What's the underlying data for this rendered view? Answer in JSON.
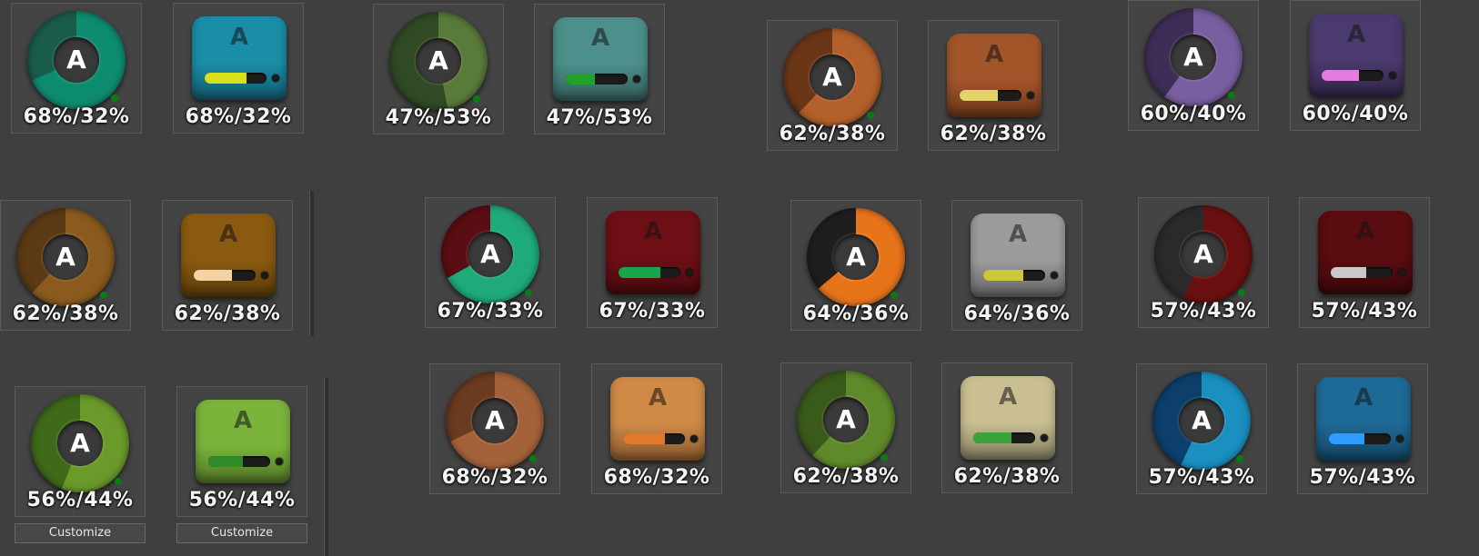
{
  "drive_letter": "A",
  "tiles": [
    {
      "caption": "68%/32%",
      "used_fraction": 0.68,
      "kind": "ring",
      "color": "#0e8c6f",
      "alt": "#1a5c4b"
    },
    {
      "caption": "68%/32%",
      "used_fraction": 0.68,
      "kind": "drive",
      "color": "#1a8ea8",
      "alt": "#d8e01a"
    },
    {
      "caption": "47%/53%",
      "used_fraction": 0.47,
      "kind": "ring",
      "color": "#5a7a3a",
      "alt": "#2f4a24"
    },
    {
      "caption": "47%/53%",
      "used_fraction": 0.47,
      "kind": "drive",
      "color": "#4d8f8a",
      "alt": "#1fa32a"
    },
    {
      "caption": "62%/38%",
      "used_fraction": 0.62,
      "kind": "ring",
      "color": "#b3602a",
      "alt": "#6b3618"
    },
    {
      "caption": "62%/38%",
      "used_fraction": 0.62,
      "kind": "drive",
      "color": "#a3552a",
      "alt": "#e2d36a"
    },
    {
      "caption": "60%/40%",
      "used_fraction": 0.6,
      "kind": "ring",
      "color": "#7a5fa0",
      "alt": "#3e2e57"
    },
    {
      "caption": "60%/40%",
      "used_fraction": 0.6,
      "kind": "drive",
      "color": "#4b3a6e",
      "alt": "#e57ae0"
    },
    {
      "caption": "62%/38%",
      "used_fraction": 0.62,
      "kind": "ring",
      "color": "#8a5a1e",
      "alt": "#5b3a15"
    },
    {
      "caption": "62%/38%",
      "used_fraction": 0.62,
      "kind": "drive",
      "color": "#8a5a10",
      "alt": "#f3d2a3"
    },
    {
      "caption": "67%/33%",
      "used_fraction": 0.67,
      "kind": "ring",
      "color": "#1faa7a",
      "alt": "#5a0d12"
    },
    {
      "caption": "67%/33%",
      "used_fraction": 0.67,
      "kind": "drive",
      "color": "#6e0f16",
      "alt": "#1aa54a"
    },
    {
      "caption": "64%/36%",
      "used_fraction": 0.64,
      "kind": "ring",
      "color": "#e8741a",
      "alt": "#1e1e1e"
    },
    {
      "caption": "64%/36%",
      "used_fraction": 0.64,
      "kind": "drive",
      "color": "#9c9c9c",
      "alt": "#c9c93a"
    },
    {
      "caption": "57%/43%",
      "used_fraction": 0.57,
      "kind": "ring",
      "color": "#6a1010",
      "alt": "#2a2a2a"
    },
    {
      "caption": "57%/43%",
      "used_fraction": 0.57,
      "kind": "drive",
      "color": "#5a0c10",
      "alt": "#c9c9c9"
    },
    {
      "caption": "56%/44%",
      "used_fraction": 0.56,
      "kind": "ring",
      "color": "#6a9a2a",
      "alt": "#3f6a1a"
    },
    {
      "caption": "56%/44%",
      "used_fraction": 0.56,
      "kind": "drive",
      "color": "#7ab43a",
      "alt": "#2f8a2a"
    },
    {
      "caption": "68%/32%",
      "used_fraction": 0.68,
      "kind": "ring",
      "color": "#a3623a",
      "alt": "#6b3a20"
    },
    {
      "caption": "68%/32%",
      "used_fraction": 0.68,
      "kind": "drive",
      "color": "#d08a46",
      "alt": "#e07a2a"
    },
    {
      "caption": "62%/38%",
      "used_fraction": 0.62,
      "kind": "ring",
      "color": "#5f8a2a",
      "alt": "#3a5a1a"
    },
    {
      "caption": "62%/38%",
      "used_fraction": 0.62,
      "kind": "drive",
      "color": "#c9bf92",
      "alt": "#3aa33a"
    },
    {
      "caption": "57%/43%",
      "used_fraction": 0.57,
      "kind": "ring",
      "color": "#1a8fc0",
      "alt": "#0c3f6a"
    },
    {
      "caption": "57%/43%",
      "used_fraction": 0.57,
      "kind": "drive",
      "color": "#1e6a96",
      "alt": "#2f9cff"
    }
  ],
  "customize_buttons": [
    "Customize",
    "Customize"
  ]
}
